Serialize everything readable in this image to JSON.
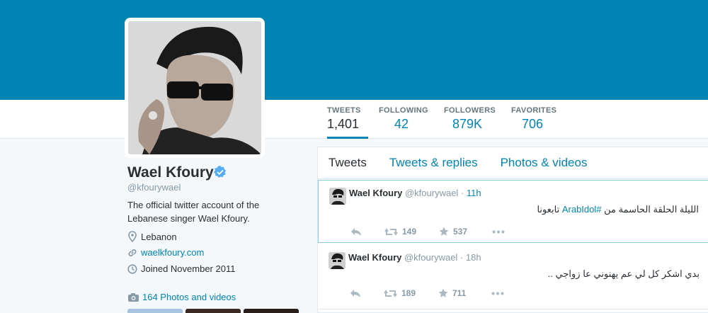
{
  "profile": {
    "name": "Wael Kfoury",
    "screen_name": "@kfourywael",
    "bio": "The official twitter account of the Lebanese singer Wael Kfoury.",
    "location": "Lebanon",
    "website": "waelkfoury.com",
    "joined": "Joined November 2011",
    "photos_label": "164 Photos and videos",
    "verified": true
  },
  "stats": [
    {
      "label": "TWEETS",
      "value": "1,401",
      "active": true
    },
    {
      "label": "FOLLOWING",
      "value": "42"
    },
    {
      "label": "FOLLOWERS",
      "value": "879K"
    },
    {
      "label": "FAVORITES",
      "value": "706"
    }
  ],
  "tabs": [
    "Tweets",
    "Tweets & replies",
    "Photos & videos"
  ],
  "tweets": [
    {
      "name": "Wael Kfoury",
      "handle": "@kfourywael",
      "sep": "·",
      "time": "11h",
      "text_before": "الليلة الحلقة الحاسمة من ",
      "hashtag": "#ArabIdol",
      "text_after": " تابعونا",
      "retweets": "149",
      "favorites": "537"
    },
    {
      "name": "Wael Kfoury",
      "handle": "@kfourywael",
      "sep": "·",
      "time": "18h",
      "text": "بدي اشكر كل لي عم يهنوني عا زواجي ..",
      "retweets": "189",
      "favorites": "711"
    }
  ],
  "colors": {
    "header": "#0084b4",
    "link": "#0084b4",
    "verified": "#55acee"
  },
  "icons": [
    "verified-icon",
    "location-icon",
    "link-icon",
    "calendar-icon",
    "camera-icon",
    "reply-icon",
    "retweet-icon",
    "favorite-star-icon",
    "more-icon"
  ]
}
